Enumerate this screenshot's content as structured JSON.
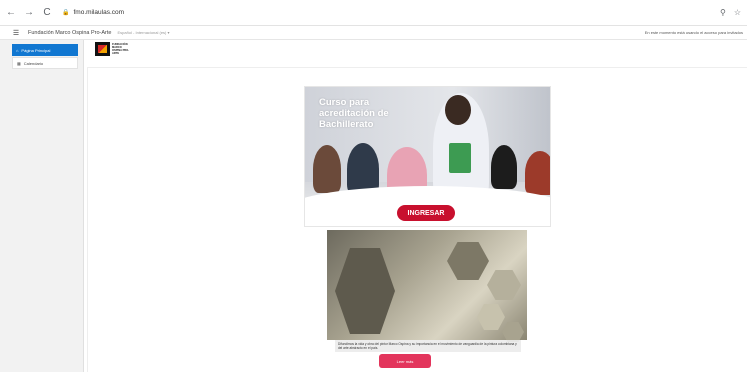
{
  "browser": {
    "back": "←",
    "forward": "→",
    "reload": "C",
    "url": "fmo.milaulas.com",
    "zoom_icon": "zoom-icon",
    "star_icon": "star-icon"
  },
  "topbar": {
    "site_name": "Fundación Marco Ospina Pro-Arte",
    "language": "Español - Internacional (es) ▾",
    "login_info": "En este momento está usando el acceso para invitados"
  },
  "sidebar": {
    "items": [
      {
        "label": "Página Principal",
        "icon": "home-icon",
        "active": true
      },
      {
        "label": "Calendario",
        "icon": "calendar-icon",
        "active": false
      }
    ]
  },
  "logo": {
    "text": "FUNDACIÓN MARCO OSPINA PRO-ARTE"
  },
  "banner1": {
    "title": "Curso para acreditación de Bachillerato",
    "button": "INGRESAR"
  },
  "banner2": {
    "description": "Difundimos la vida y obra del pintor Marco Ospina y su importancia en el movimiento de vanguardia de la pintura colombiana y del arte abstracto en el país.",
    "button": "Leer más"
  },
  "colors": {
    "primary_blue": "#1177d1",
    "ingresar_red": "#c8102e",
    "leer_pink": "#e3355c"
  }
}
